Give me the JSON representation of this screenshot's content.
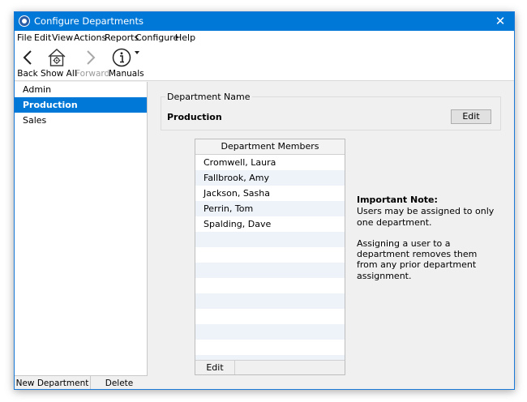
{
  "window": {
    "title": "Configure Departments",
    "close_glyph": "✕"
  },
  "menu": [
    "File",
    "Edit",
    "View",
    "Actions",
    "Reports",
    "Configure",
    "Help"
  ],
  "toolbar": {
    "back": "Back",
    "show_all": "Show All",
    "forward": "Forward",
    "manuals": "Manuals"
  },
  "sidebar": {
    "items": [
      {
        "label": "Admin",
        "selected": false
      },
      {
        "label": "Production",
        "selected": true
      },
      {
        "label": "Sales",
        "selected": false
      }
    ],
    "new_department": "New Department",
    "delete": "Delete"
  },
  "department": {
    "legend": "Department Name",
    "name": "Production",
    "edit": "Edit"
  },
  "members": {
    "header": "Department Members",
    "rows": [
      "Cromwell, Laura",
      "Fallbrook, Amy",
      "Jackson, Sasha",
      "Perrin, Tom",
      "Spalding, Dave"
    ],
    "edit": "Edit"
  },
  "note": {
    "title": "Important Note:",
    "line1": "Users may be assigned to only one department.",
    "line2": "Assigning a user to a department removes them from any prior department assignment."
  },
  "icons": {
    "app": "app-icon",
    "back": "chevron-left-icon",
    "show_all": "house-gear-icon",
    "forward": "chevron-right-icon",
    "manuals": "info-icon",
    "dropdown": "caret-down-icon"
  },
  "colors": {
    "accent": "#0078d7"
  }
}
